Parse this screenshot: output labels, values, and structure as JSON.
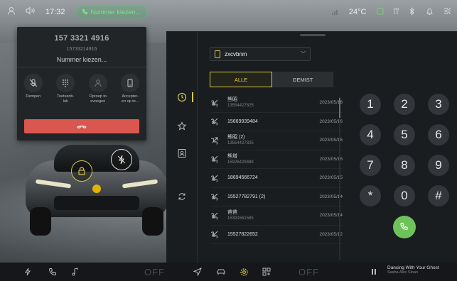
{
  "status_bar": {
    "time": "17:32",
    "call_pill": "Nummer kiezen...",
    "temperature": "24°C",
    "pm_top": "PM",
    "pm_bottom": "2.5"
  },
  "call_overlay": {
    "number": "157 3321 4916",
    "number_small": "15733214916",
    "state": "Nummer kiezen...",
    "actions": [
      {
        "label": "Dempen"
      },
      {
        "label": "Toetsenb-\nlok"
      },
      {
        "label": "Oproep to\nevoegen"
      },
      {
        "label": "Accepter-\nen op te..."
      }
    ]
  },
  "phone": {
    "device_name": "zxcvbnm",
    "tabs": [
      {
        "label": "ALLE",
        "active": true
      },
      {
        "label": "GEMIST",
        "active": false
      }
    ],
    "calls": [
      {
        "name": "熊昭",
        "number": "13554427825",
        "date": "2023/05/16",
        "type": "incoming"
      },
      {
        "name": "15669939484",
        "number": "",
        "date": "2023/05/16",
        "type": "incoming"
      },
      {
        "name": "熊昭 (2)",
        "number": "13554427825",
        "date": "2023/05/16",
        "type": "outgoing"
      },
      {
        "name": "熊增",
        "number": "15926429488",
        "date": "2023/05/16",
        "type": "incoming"
      },
      {
        "name": "18694566724",
        "number": "",
        "date": "2023/05/15",
        "type": "incoming"
      },
      {
        "name": "15527782791 (2)",
        "number": "",
        "date": "2023/05/14",
        "type": "incoming"
      },
      {
        "name": "爸爸",
        "number": "15391561585",
        "date": "2023/05/14",
        "type": "incoming"
      },
      {
        "name": "15527822652",
        "number": "",
        "date": "2023/05/12",
        "type": "incoming"
      }
    ],
    "keypad": [
      "1",
      "2",
      "3",
      "4",
      "5",
      "6",
      "7",
      "8",
      "9",
      "*",
      "0",
      "#"
    ]
  },
  "dock": {
    "off_left": "OFF",
    "off_right": "OFF",
    "media_title": "Dancing With Your Ghost",
    "media_artist": "Sasha Alex Sloan"
  },
  "colors": {
    "accent": "#d8c84a",
    "hangup": "#d9574f",
    "call_green": "#6ec25a",
    "pill_green": "#7fe08f"
  }
}
